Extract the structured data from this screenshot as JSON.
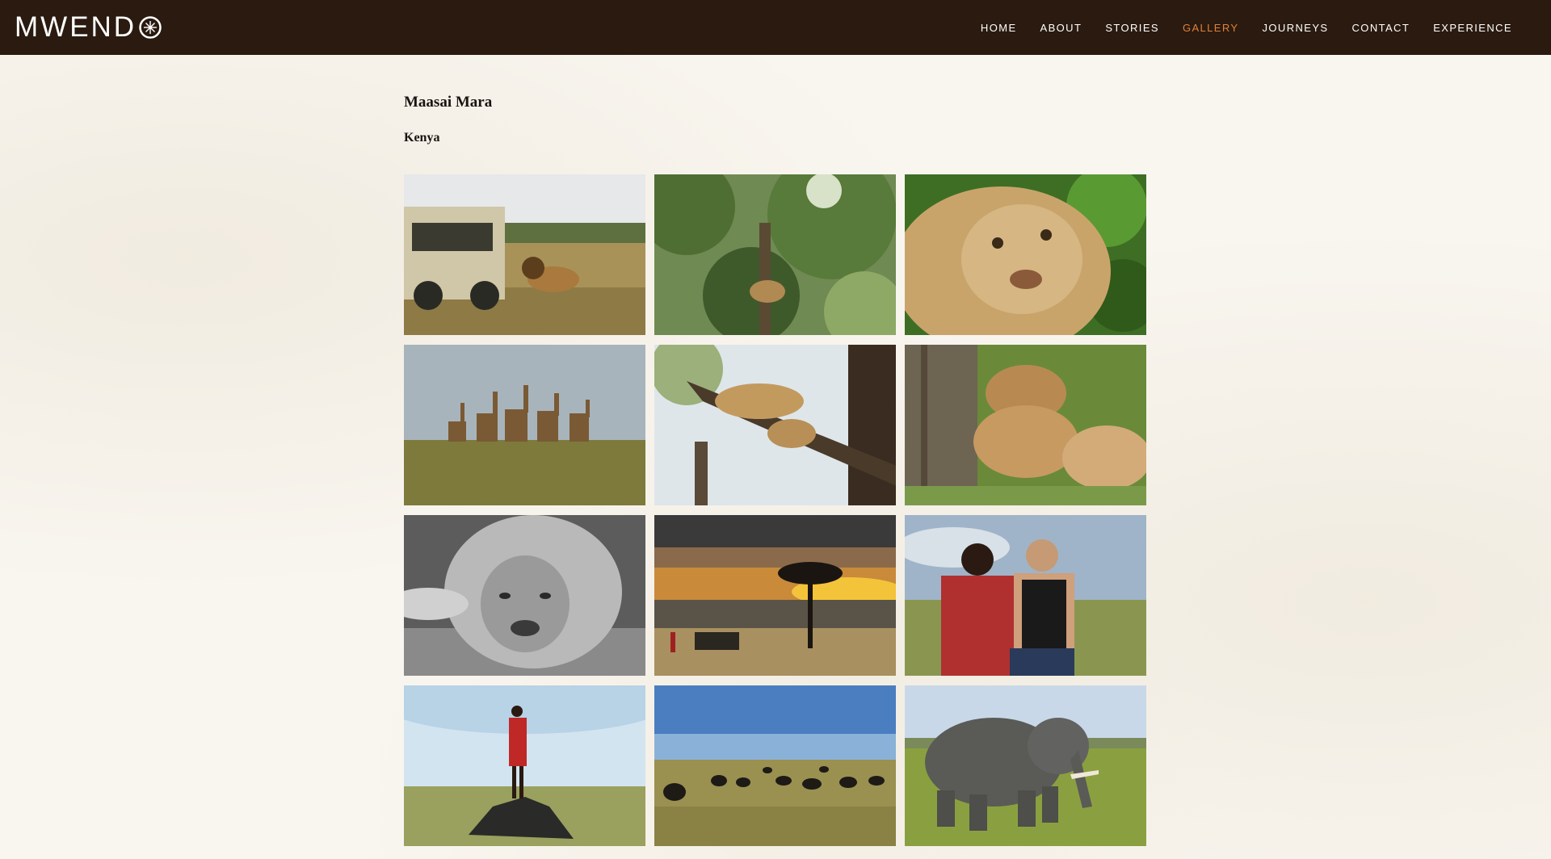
{
  "site": {
    "logo_text": "MWEND",
    "logo_icon": "compass-o-icon"
  },
  "nav": {
    "items": [
      {
        "label": "HOME",
        "active": false
      },
      {
        "label": "ABOUT",
        "active": false
      },
      {
        "label": "STORIES",
        "active": false
      },
      {
        "label": "GALLERY",
        "active": true
      },
      {
        "label": "JOURNEYS",
        "active": false
      },
      {
        "label": "CONTACT",
        "active": false
      },
      {
        "label": "EXPERIENCE",
        "active": false
      }
    ]
  },
  "colors": {
    "header_bg": "#2a1a0f",
    "nav_active": "#e0803a",
    "nav_text": "#ffffff",
    "page_bg": "#f9f6f0"
  },
  "gallery": {
    "title": "Maasai Mara",
    "subtitle": "Kenya",
    "photos": [
      {
        "name": "photo-safari-jeep-lion",
        "icon": "safari-jeep-lion-image"
      },
      {
        "name": "photo-leopard-in-tree",
        "icon": "tree-canopy-image"
      },
      {
        "name": "photo-lion-closeup",
        "icon": "lion-face-image"
      },
      {
        "name": "photo-giraffes",
        "icon": "giraffes-image"
      },
      {
        "name": "photo-lioness-on-branch",
        "icon": "lioness-tree-image"
      },
      {
        "name": "photo-lionesses-resting",
        "icon": "lionesses-image"
      },
      {
        "name": "photo-lion-black-white",
        "icon": "lion-bw-image"
      },
      {
        "name": "photo-acacia-sunset",
        "icon": "acacia-sunset-image"
      },
      {
        "name": "photo-maasai-and-traveler",
        "icon": "people-portrait-image"
      },
      {
        "name": "photo-maasai-on-termite-mound",
        "icon": "maasai-warrior-image"
      },
      {
        "name": "photo-buffalo-herd",
        "icon": "buffalo-herd-image"
      },
      {
        "name": "photo-elephant",
        "icon": "elephant-image"
      }
    ]
  }
}
